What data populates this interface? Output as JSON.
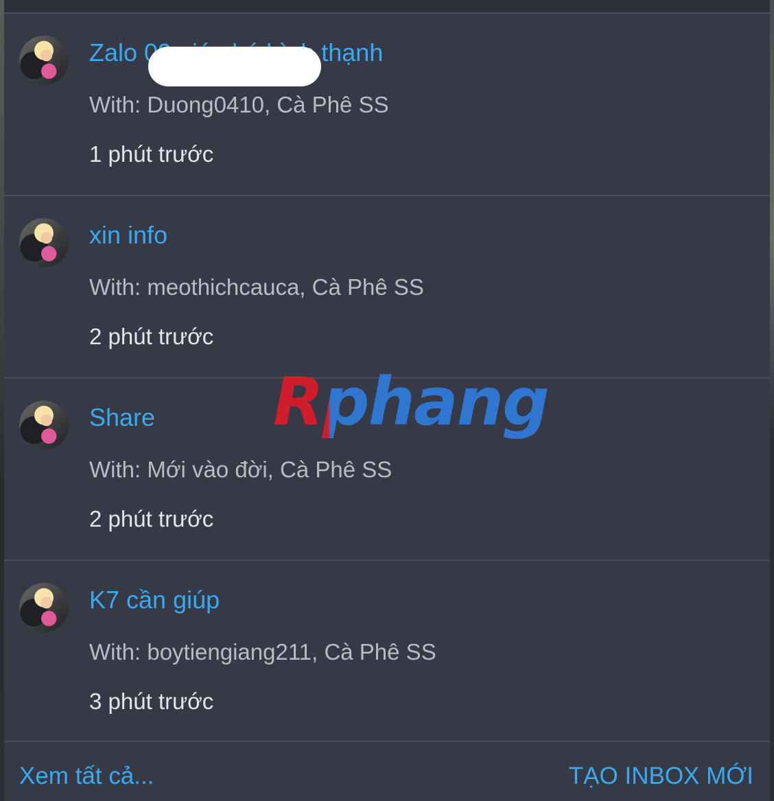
{
  "conversations": [
    {
      "title": "Zalo 09 giúp bé bình thạnh",
      "with": "With: Duong0410, Cà Phê SS",
      "time": "1 phút trước",
      "redacted": true
    },
    {
      "title": "xin info",
      "with": "With: meothichcauca, Cà Phê SS",
      "time": "2 phút trước"
    },
    {
      "title": "Share",
      "with": "With: Mới vào đời, Cà Phê SS",
      "time": "2 phút trước"
    },
    {
      "title": "K7 cần giúp",
      "with": "With: boytiengiang211, Cà Phê SS",
      "time": "3 phút trước"
    }
  ],
  "footer": {
    "see_all": "Xem tất cả...",
    "new_inbox": "TẠO INBOX MỚI"
  },
  "watermark": "Rphang",
  "colors": {
    "panel": "#363a47",
    "accent": "#3aa9ef",
    "text_muted": "#b9bcc4",
    "text_time": "#e3e5ea"
  }
}
